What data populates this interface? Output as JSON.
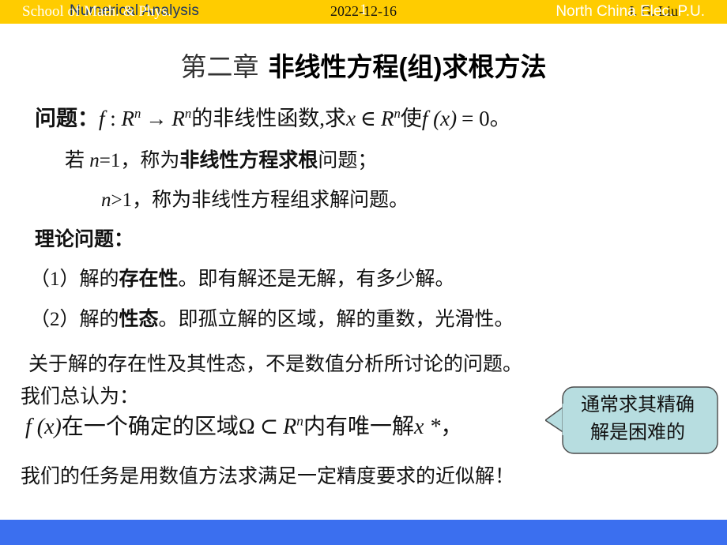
{
  "header": {
    "course_title": "Numerical Analysis",
    "date": "2022-12-16",
    "author": "J. G. Liu",
    "background_color": "#FFCC00",
    "title_color": "#1F3864"
  },
  "slide": {
    "title_chapter": "第二章",
    "title_subject": "非线性方程(组)求根方法",
    "problem_line": {
      "label": "问题：",
      "text_f": "f",
      "colon": " : ",
      "domain": "R",
      "domain_sup": "n",
      "arrow": "→",
      "codomain": "R",
      "codomain_sup": "n",
      "mid_cn": "的非线性函数,求",
      "var_x": "x",
      "member": "∈",
      "space": "R",
      "space_sup": "n",
      "cn_make": "使",
      "fx": "f (x)",
      "equals": "= 0。"
    },
    "case_n_eq_1": {
      "prefix": "若 ",
      "n": "n",
      "eq": "=1，称为",
      "bold": "非线性方程求根",
      "suffix": "问题；"
    },
    "case_n_gt_1": {
      "n": "n",
      "rest": ">1，称为非线性方程组求解问题。"
    },
    "theory_heading": "理论问题：",
    "items": [
      {
        "number": "（1）",
        "prefix": "解的",
        "bold": "存在性",
        "suffix": "。即有解还是无解，有多少解。"
      },
      {
        "number": "（2）",
        "prefix": "解的",
        "bold": "性态",
        "suffix": "。即孤立解的区域，解的重数，光滑性。"
      }
    ],
    "remark": " 关于解的存在性及其性态，不是数值分析所讨论的问题。",
    "we_assume": "我们总认为：",
    "formula": {
      "fx": "f (x)",
      "cn1": "在一个确定的区域",
      "omega": "Ω",
      "subset": "⊂",
      "space": "R",
      "space_sup": "n",
      "cn2": "内有唯一解",
      "x_star": "x *",
      "comma": "，"
    },
    "task": "我们的任务是用数值方法求满足一定精度要求的近似解！"
  },
  "callout": {
    "line1": "通常求其精确",
    "line2": "解是困难的",
    "fill_color": "#B7DDE0",
    "border_color": "#4A4A4A"
  },
  "footer": {
    "school": "School of Math. & Phys.",
    "page_number": "1",
    "university": "North China Elec. P.U.",
    "background_color": "#3B6FEF",
    "text_color": "#FFFFFF"
  }
}
